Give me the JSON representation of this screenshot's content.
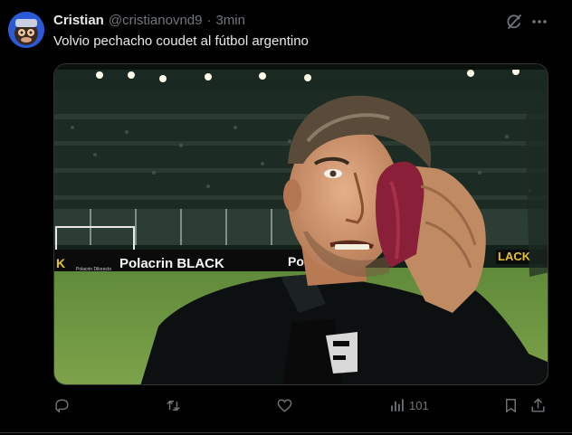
{
  "tweet": {
    "author_name": "Cristian",
    "handle": "@cristianovnd9",
    "separator": "·",
    "time": "3min",
    "text": "Volvio pechacho coudet al fútbol argentino",
    "media": {
      "ad_boards": [
        "K",
        "Polacrin BLACK",
        "Pol",
        "LACK"
      ],
      "ad_board_small": "Polacrin Dilorecto"
    },
    "actions": {
      "views": "101"
    }
  },
  "colors": {
    "background": "#000000",
    "text_primary": "#e7e9ea",
    "text_secondary": "#71767b",
    "border": "#2f3336"
  },
  "icons": [
    "avatar",
    "grok-icon",
    "more-icon",
    "reply-icon",
    "retweet-icon",
    "like-icon",
    "views-icon",
    "bookmark-icon",
    "share-icon"
  ]
}
